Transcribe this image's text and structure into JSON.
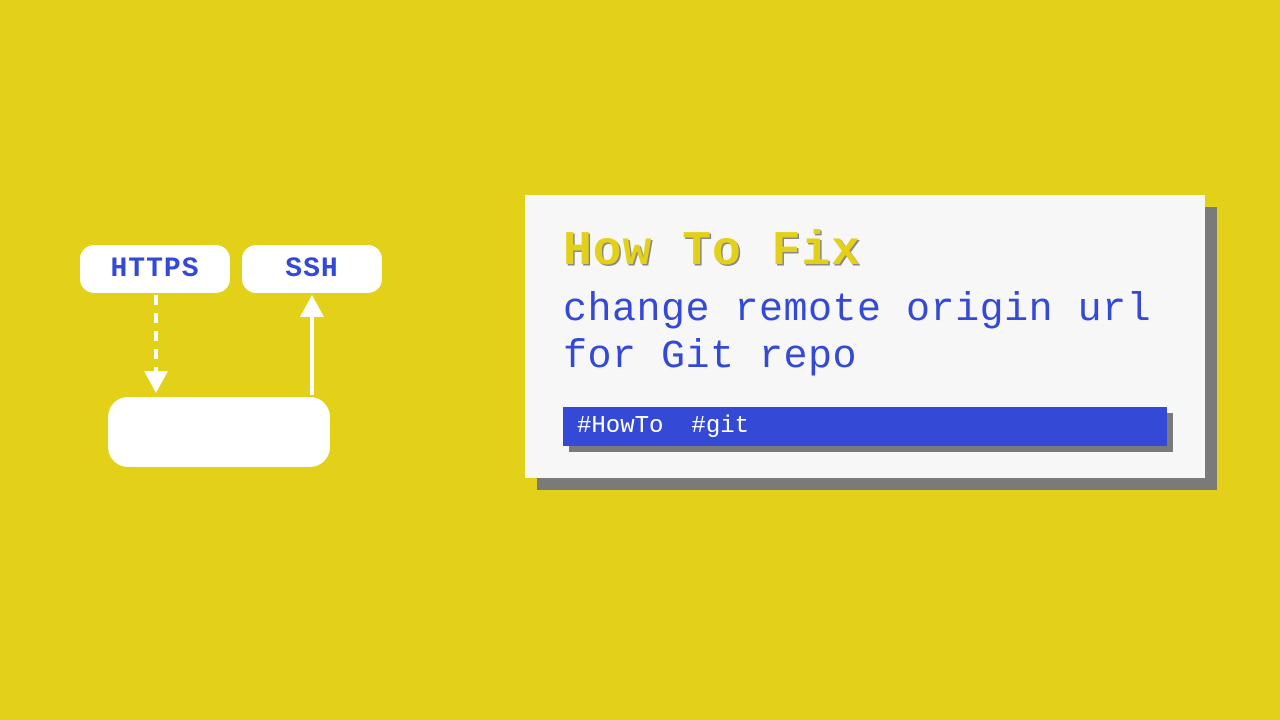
{
  "diagram": {
    "https_label": "HTTPS",
    "ssh_label": "SSH"
  },
  "card": {
    "title": "How To Fix",
    "subtitle": "change remote origin url for Git repo",
    "tags": [
      "#HowTo",
      "#git"
    ]
  }
}
